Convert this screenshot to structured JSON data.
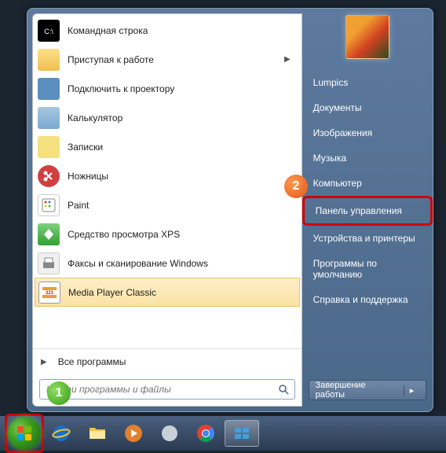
{
  "left_panel": {
    "programs": [
      {
        "label": "Командная строка",
        "icon": "cmd",
        "has_submenu": false
      },
      {
        "label": "Приступая к работе",
        "icon": "folder",
        "has_submenu": true
      },
      {
        "label": "Подключить к проектору",
        "icon": "projector",
        "has_submenu": false
      },
      {
        "label": "Калькулятор",
        "icon": "calc",
        "has_submenu": false
      },
      {
        "label": "Записки",
        "icon": "notes",
        "has_submenu": false
      },
      {
        "label": "Ножницы",
        "icon": "snip",
        "has_submenu": false
      },
      {
        "label": "Paint",
        "icon": "paint",
        "has_submenu": false
      },
      {
        "label": "Средство просмотра XPS",
        "icon": "xps",
        "has_submenu": false
      },
      {
        "label": "Факсы и сканирование Windows",
        "icon": "fax",
        "has_submenu": false
      },
      {
        "label": "Media Player Classic",
        "icon": "mpc",
        "has_submenu": false,
        "hovered": true
      }
    ],
    "all_programs_label": "Все программы",
    "search_placeholder": "Найти программы и файлы"
  },
  "right_panel": {
    "items": [
      "Lumpics",
      "Документы",
      "Изображения",
      "Музыка",
      "Компьютер",
      "Панель управления",
      "Устройства и принтеры",
      "Программы по умолчанию",
      "Справка и поддержка"
    ],
    "shutdown_label": "Завершение работы"
  },
  "callouts": {
    "c1": "1",
    "c2": "2"
  }
}
